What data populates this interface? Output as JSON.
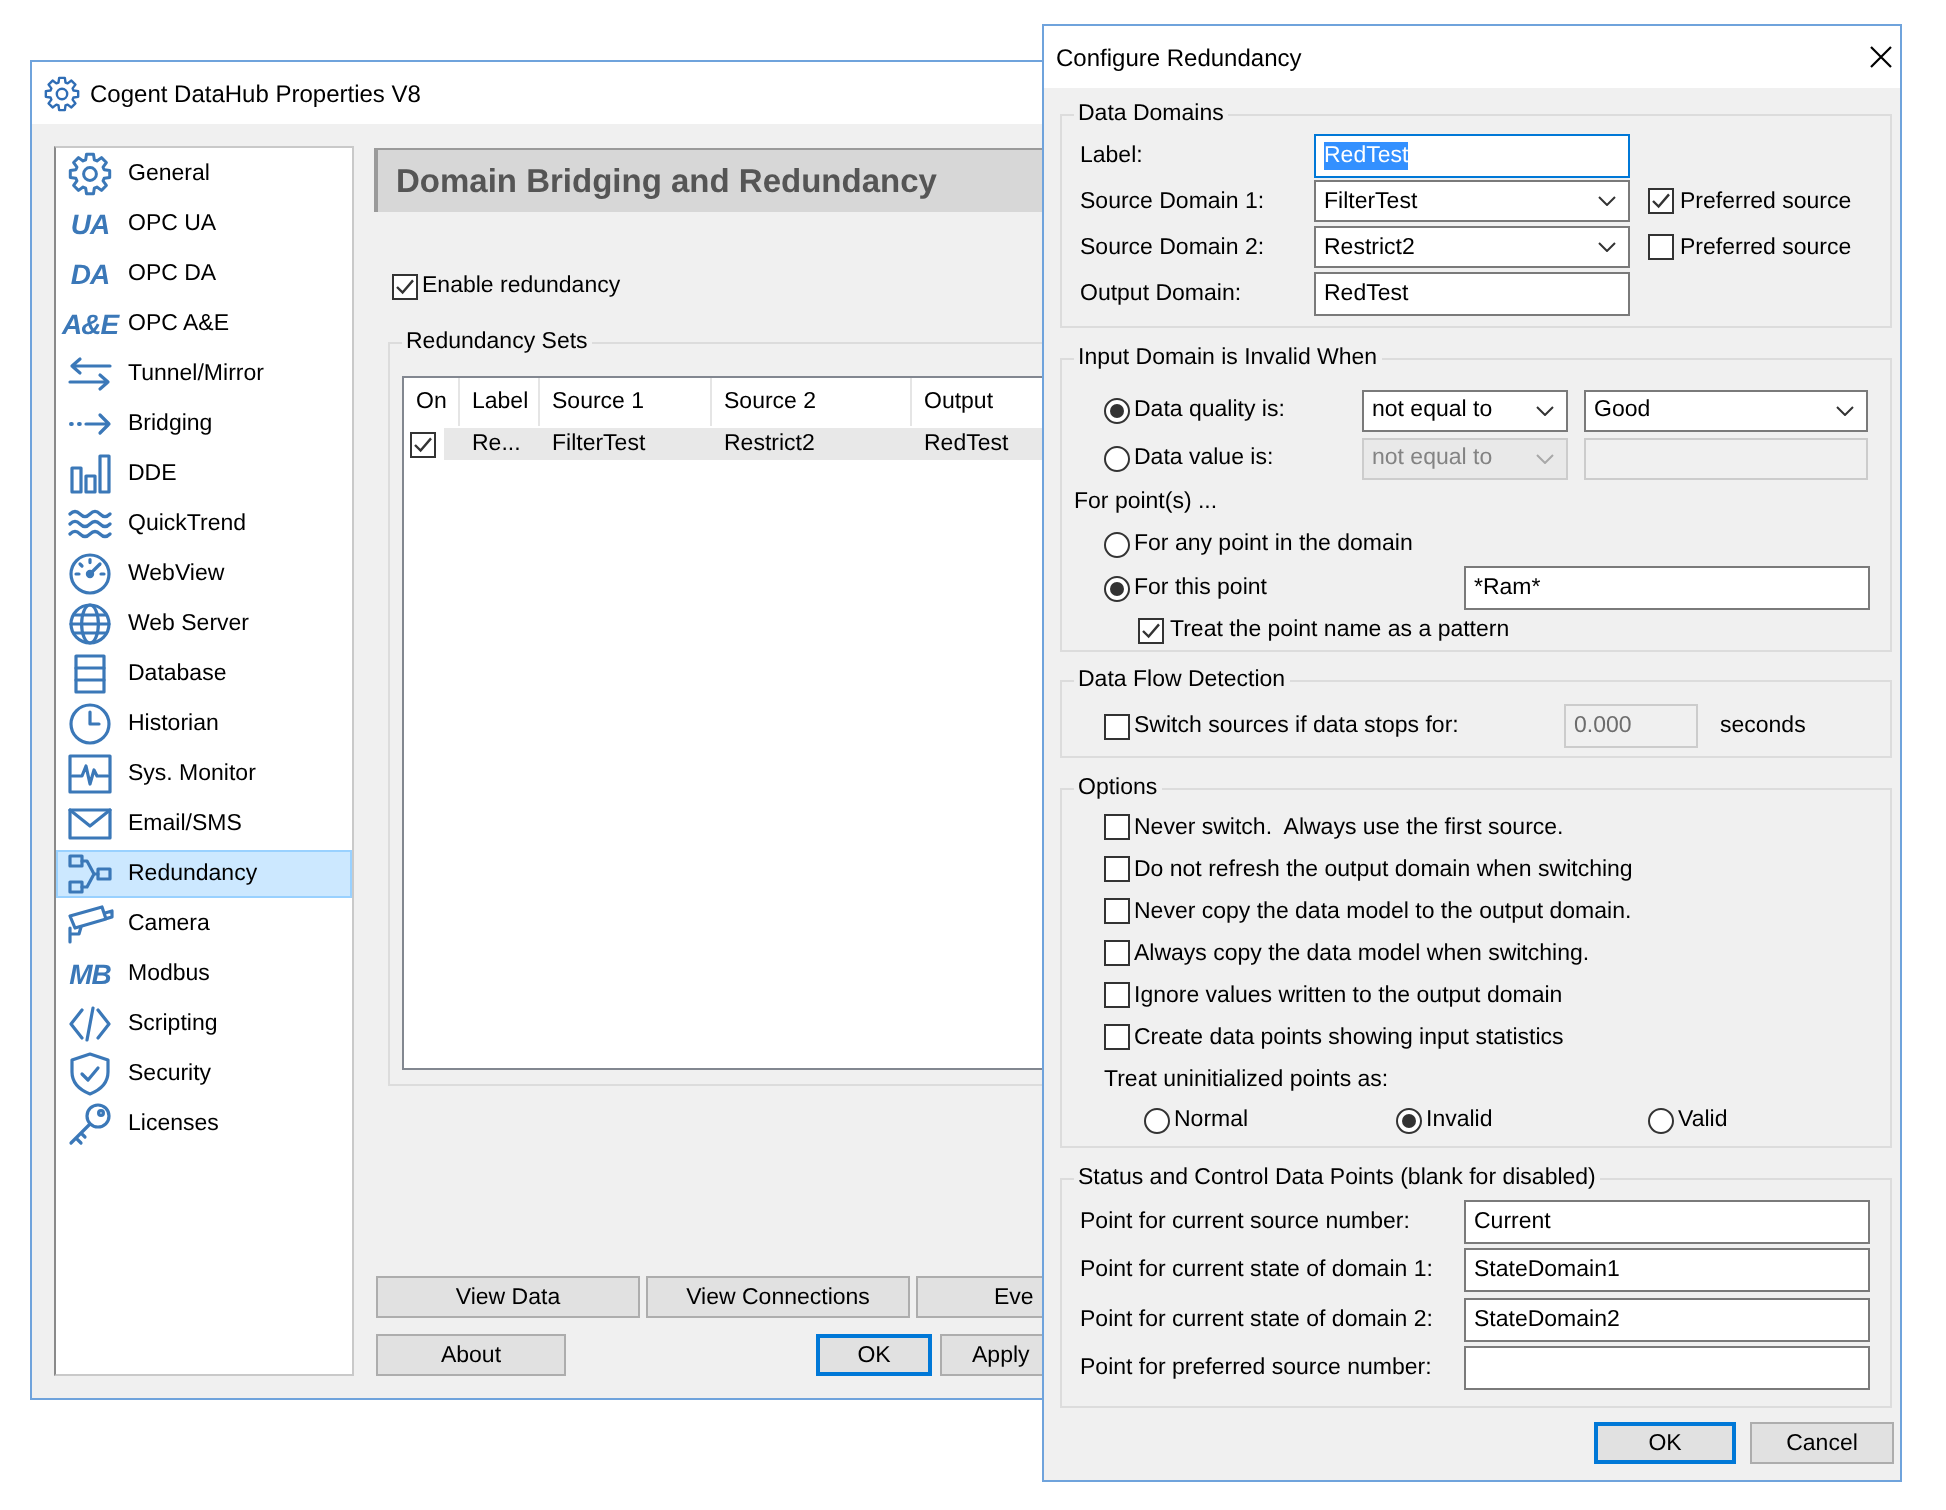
{
  "main_window": {
    "title": "Cogent DataHub Properties V8",
    "sidebar": {
      "items": [
        {
          "label": "General",
          "selected": false
        },
        {
          "label": "OPC UA",
          "icon_text": "UA",
          "selected": false
        },
        {
          "label": "OPC DA",
          "icon_text": "DA",
          "selected": false
        },
        {
          "label": "OPC A&E",
          "icon_text": "A&E",
          "selected": false
        },
        {
          "label": "Tunnel/Mirror",
          "selected": false
        },
        {
          "label": "Bridging",
          "selected": false
        },
        {
          "label": "DDE",
          "selected": false
        },
        {
          "label": "QuickTrend",
          "selected": false
        },
        {
          "label": "WebView",
          "selected": false
        },
        {
          "label": "Web Server",
          "selected": false
        },
        {
          "label": "Database",
          "selected": false
        },
        {
          "label": "Historian",
          "selected": false
        },
        {
          "label": "Sys. Monitor",
          "selected": false
        },
        {
          "label": "Email/SMS",
          "selected": false
        },
        {
          "label": "Redundancy",
          "selected": true
        },
        {
          "label": "Camera",
          "selected": false
        },
        {
          "label": "Modbus",
          "icon_text": "MB",
          "selected": false
        },
        {
          "label": "Scripting",
          "selected": false
        },
        {
          "label": "Security",
          "selected": false
        },
        {
          "label": "Licenses",
          "selected": false
        }
      ]
    },
    "heading": "Domain Bridging and Redundancy",
    "enable_redundancy": {
      "label": "Enable redundancy",
      "checked": true
    },
    "redundancy_sets": {
      "title": "Redundancy Sets",
      "columns": [
        "On",
        "Label",
        "Source 1",
        "Source 2",
        "Output"
      ],
      "rows": [
        {
          "on": true,
          "label": "Re...",
          "source_1": "FilterTest",
          "source_2": "Restrict2",
          "output": "RedTest",
          "selected": true
        }
      ]
    },
    "action_buttons": [
      "View Data",
      "View Connections",
      "Eve"
    ],
    "footer_buttons": [
      {
        "label": "About",
        "default": false
      },
      {
        "label": "OK",
        "default": true
      },
      {
        "label": "Apply",
        "default": false
      }
    ]
  },
  "dialog": {
    "title": "Configure Redundancy",
    "data_domains": {
      "title": "Data Domains",
      "label": {
        "label": "Label:",
        "value": "RedTest",
        "focused": true
      },
      "sources": [
        {
          "label": "Source Domain 1:",
          "value": "FilterTest",
          "preferred": {
            "label": "Preferred source",
            "checked": true
          }
        },
        {
          "label": "Source Domain 2:",
          "value": "Restrict2",
          "preferred": {
            "label": "Preferred source",
            "checked": false
          }
        }
      ],
      "output": {
        "label": "Output Domain:",
        "value": "RedTest"
      }
    },
    "invalid_when": {
      "title": "Input Domain is Invalid When",
      "conditions": [
        {
          "label": "Data quality is:",
          "selected": true,
          "operator": {
            "value": "not equal to",
            "disabled": false
          },
          "operand": {
            "kind": "dropdown",
            "value": "Good",
            "disabled": false
          }
        },
        {
          "label": "Data value is:",
          "selected": false,
          "operator": {
            "value": "not equal to",
            "disabled": true
          },
          "operand": {
            "kind": "text",
            "disabled": true
          }
        }
      ],
      "points_label": "For point(s) ...",
      "scopes": [
        {
          "label": "For any point in the domain",
          "selected": false
        },
        {
          "label": "For this point",
          "selected": true,
          "value": "*Ram*"
        }
      ],
      "pattern": {
        "label": "Treat the point name as a pattern",
        "checked": true
      }
    },
    "data_flow": {
      "title": "Data Flow Detection",
      "switch": {
        "label": "Switch sources if data stops for:",
        "checked": false
      },
      "timeout": {
        "value": "0.000",
        "disabled": true
      },
      "unit": "seconds"
    },
    "options": {
      "title": "Options",
      "checks": [
        {
          "label": "Never switch.  Always use the first source.",
          "checked": false
        },
        {
          "label": "Do not refresh the output domain when switching",
          "checked": false
        },
        {
          "label": "Never copy the data model to the output domain.",
          "checked": false
        },
        {
          "label": "Always copy the data model when switching.",
          "checked": false
        },
        {
          "label": "Ignore values written to the output domain",
          "checked": false
        },
        {
          "label": "Create data points showing input statistics",
          "checked": false
        }
      ],
      "uninitialized": {
        "label": "Treat uninitialized points as:",
        "choices": [
          {
            "label": "Normal",
            "selected": false
          },
          {
            "label": "Invalid",
            "selected": true
          },
          {
            "label": "Valid",
            "selected": false
          }
        ]
      }
    },
    "status_points": {
      "title": "Status and Control Data Points (blank for disabled)",
      "rows": [
        {
          "label": "Point for current source number:",
          "value": "Current"
        },
        {
          "label": "Point for current state of domain 1:",
          "value": "StateDomain1"
        },
        {
          "label": "Point for current state of domain 2:",
          "value": "StateDomain2"
        },
        {
          "label": "Point for preferred source number:"
        }
      ]
    },
    "buttons": [
      {
        "label": "OK",
        "default": true
      },
      {
        "label": "Cancel",
        "default": false
      }
    ]
  }
}
